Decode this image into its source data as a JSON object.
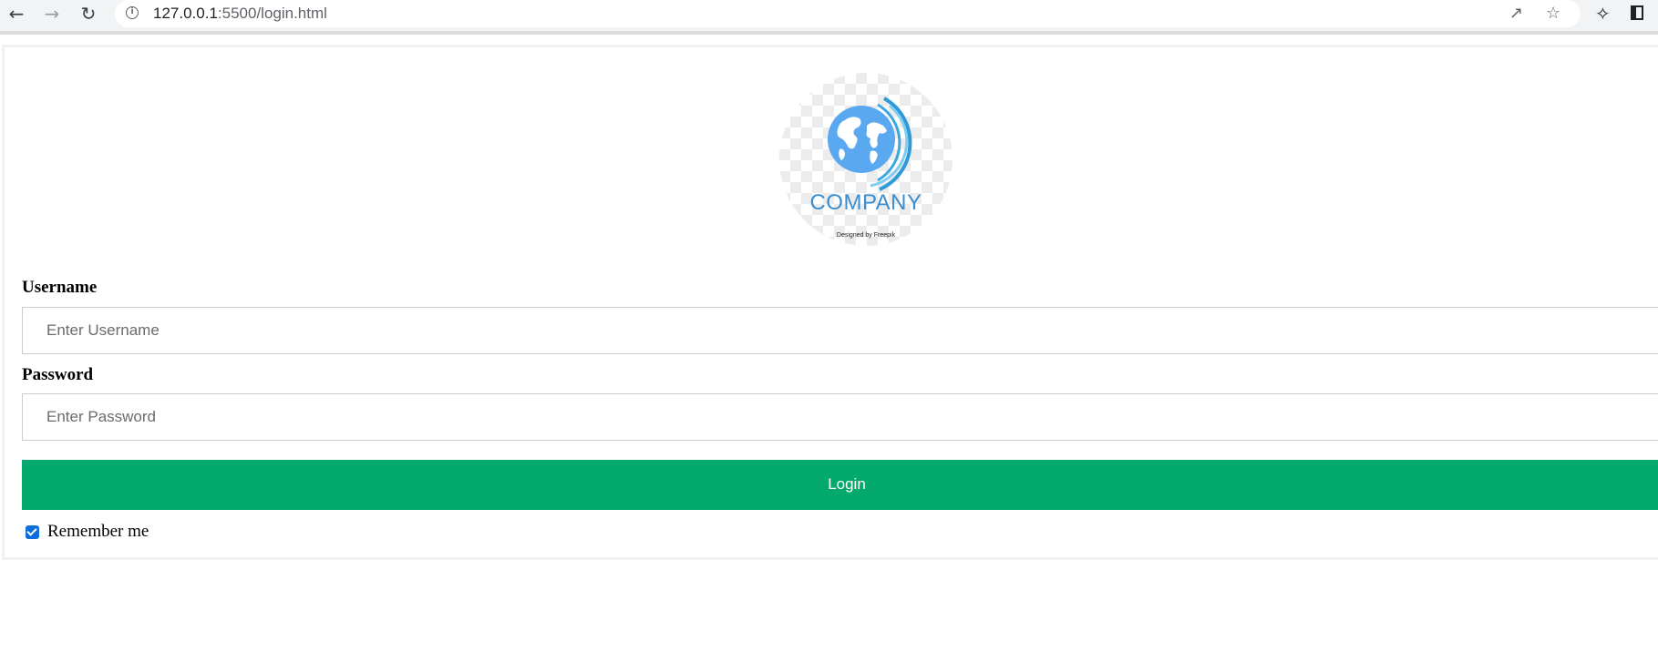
{
  "browser": {
    "url_host": "127.0.0.1",
    "url_rest": ":5500/login.html",
    "icons": {
      "back": "arrow-left-icon",
      "forward": "arrow-right-icon",
      "reload": "reload-icon",
      "info": "info-icon",
      "share": "share-icon",
      "bookmark": "star-icon",
      "extensions": "puzzle-icon",
      "window": "side-panel-icon"
    }
  },
  "logo": {
    "company": "COMPANY",
    "credit": "Designed by Freepik",
    "colors": {
      "globe": "#5aa8ef",
      "swoosh": "#2f9ad8",
      "text": "#3a8ed0"
    }
  },
  "form": {
    "username_label": "Username",
    "username_placeholder": "Enter Username",
    "password_label": "Password",
    "password_placeholder": "Enter Password",
    "login_label": "Login",
    "remember_label": "Remember me",
    "remember_checked": true,
    "button_color": "#04aa6d"
  }
}
